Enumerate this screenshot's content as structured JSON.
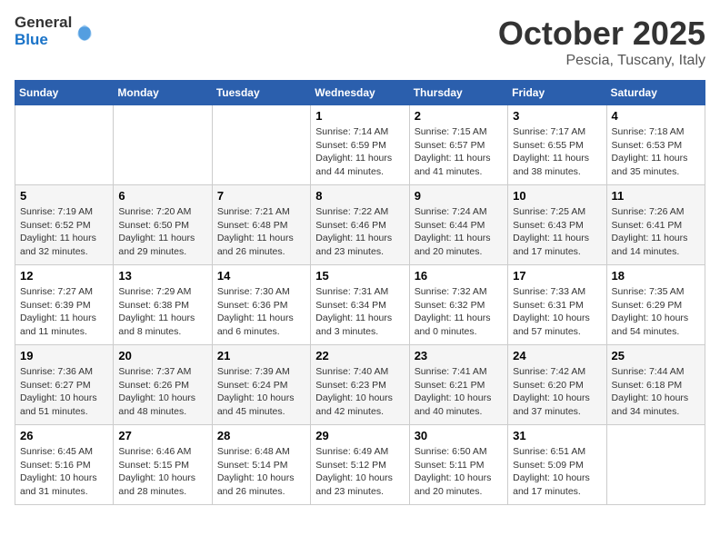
{
  "logo": {
    "general": "General",
    "blue": "Blue"
  },
  "header": {
    "month": "October 2025",
    "location": "Pescia, Tuscany, Italy"
  },
  "weekdays": [
    "Sunday",
    "Monday",
    "Tuesday",
    "Wednesday",
    "Thursday",
    "Friday",
    "Saturday"
  ],
  "weeks": [
    [
      {
        "day": "",
        "info": ""
      },
      {
        "day": "",
        "info": ""
      },
      {
        "day": "",
        "info": ""
      },
      {
        "day": "1",
        "info": "Sunrise: 7:14 AM\nSunset: 6:59 PM\nDaylight: 11 hours and 44 minutes."
      },
      {
        "day": "2",
        "info": "Sunrise: 7:15 AM\nSunset: 6:57 PM\nDaylight: 11 hours and 41 minutes."
      },
      {
        "day": "3",
        "info": "Sunrise: 7:17 AM\nSunset: 6:55 PM\nDaylight: 11 hours and 38 minutes."
      },
      {
        "day": "4",
        "info": "Sunrise: 7:18 AM\nSunset: 6:53 PM\nDaylight: 11 hours and 35 minutes."
      }
    ],
    [
      {
        "day": "5",
        "info": "Sunrise: 7:19 AM\nSunset: 6:52 PM\nDaylight: 11 hours and 32 minutes."
      },
      {
        "day": "6",
        "info": "Sunrise: 7:20 AM\nSunset: 6:50 PM\nDaylight: 11 hours and 29 minutes."
      },
      {
        "day": "7",
        "info": "Sunrise: 7:21 AM\nSunset: 6:48 PM\nDaylight: 11 hours and 26 minutes."
      },
      {
        "day": "8",
        "info": "Sunrise: 7:22 AM\nSunset: 6:46 PM\nDaylight: 11 hours and 23 minutes."
      },
      {
        "day": "9",
        "info": "Sunrise: 7:24 AM\nSunset: 6:44 PM\nDaylight: 11 hours and 20 minutes."
      },
      {
        "day": "10",
        "info": "Sunrise: 7:25 AM\nSunset: 6:43 PM\nDaylight: 11 hours and 17 minutes."
      },
      {
        "day": "11",
        "info": "Sunrise: 7:26 AM\nSunset: 6:41 PM\nDaylight: 11 hours and 14 minutes."
      }
    ],
    [
      {
        "day": "12",
        "info": "Sunrise: 7:27 AM\nSunset: 6:39 PM\nDaylight: 11 hours and 11 minutes."
      },
      {
        "day": "13",
        "info": "Sunrise: 7:29 AM\nSunset: 6:38 PM\nDaylight: 11 hours and 8 minutes."
      },
      {
        "day": "14",
        "info": "Sunrise: 7:30 AM\nSunset: 6:36 PM\nDaylight: 11 hours and 6 minutes."
      },
      {
        "day": "15",
        "info": "Sunrise: 7:31 AM\nSunset: 6:34 PM\nDaylight: 11 hours and 3 minutes."
      },
      {
        "day": "16",
        "info": "Sunrise: 7:32 AM\nSunset: 6:32 PM\nDaylight: 11 hours and 0 minutes."
      },
      {
        "day": "17",
        "info": "Sunrise: 7:33 AM\nSunset: 6:31 PM\nDaylight: 10 hours and 57 minutes."
      },
      {
        "day": "18",
        "info": "Sunrise: 7:35 AM\nSunset: 6:29 PM\nDaylight: 10 hours and 54 minutes."
      }
    ],
    [
      {
        "day": "19",
        "info": "Sunrise: 7:36 AM\nSunset: 6:27 PM\nDaylight: 10 hours and 51 minutes."
      },
      {
        "day": "20",
        "info": "Sunrise: 7:37 AM\nSunset: 6:26 PM\nDaylight: 10 hours and 48 minutes."
      },
      {
        "day": "21",
        "info": "Sunrise: 7:39 AM\nSunset: 6:24 PM\nDaylight: 10 hours and 45 minutes."
      },
      {
        "day": "22",
        "info": "Sunrise: 7:40 AM\nSunset: 6:23 PM\nDaylight: 10 hours and 42 minutes."
      },
      {
        "day": "23",
        "info": "Sunrise: 7:41 AM\nSunset: 6:21 PM\nDaylight: 10 hours and 40 minutes."
      },
      {
        "day": "24",
        "info": "Sunrise: 7:42 AM\nSunset: 6:20 PM\nDaylight: 10 hours and 37 minutes."
      },
      {
        "day": "25",
        "info": "Sunrise: 7:44 AM\nSunset: 6:18 PM\nDaylight: 10 hours and 34 minutes."
      }
    ],
    [
      {
        "day": "26",
        "info": "Sunrise: 6:45 AM\nSunset: 5:16 PM\nDaylight: 10 hours and 31 minutes."
      },
      {
        "day": "27",
        "info": "Sunrise: 6:46 AM\nSunset: 5:15 PM\nDaylight: 10 hours and 28 minutes."
      },
      {
        "day": "28",
        "info": "Sunrise: 6:48 AM\nSunset: 5:14 PM\nDaylight: 10 hours and 26 minutes."
      },
      {
        "day": "29",
        "info": "Sunrise: 6:49 AM\nSunset: 5:12 PM\nDaylight: 10 hours and 23 minutes."
      },
      {
        "day": "30",
        "info": "Sunrise: 6:50 AM\nSunset: 5:11 PM\nDaylight: 10 hours and 20 minutes."
      },
      {
        "day": "31",
        "info": "Sunrise: 6:51 AM\nSunset: 5:09 PM\nDaylight: 10 hours and 17 minutes."
      },
      {
        "day": "",
        "info": ""
      }
    ]
  ]
}
